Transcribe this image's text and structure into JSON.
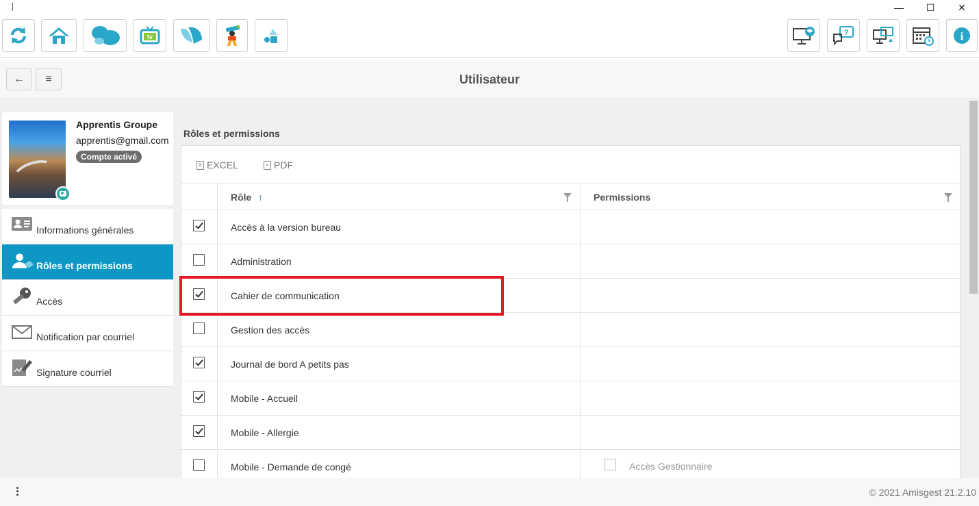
{
  "window": {
    "minimize": "—",
    "maximize": "☐",
    "close": "✕"
  },
  "toolbar": {
    "left_buttons": [
      "refresh-icon",
      "home-icon",
      "butterfly-icon",
      "tv-icon",
      "wings-icon",
      "kid-icon",
      "shapes-icon"
    ],
    "right_buttons": [
      "desktop-training-icon",
      "help-chat-icon",
      "remote-desktop-icon",
      "calendar-icon",
      "info-icon"
    ],
    "tv_label": "tv",
    "help_label": "?",
    "info_label": "i"
  },
  "header": {
    "back_icon": "←",
    "menu_icon": "≡",
    "title": "Utilisateur"
  },
  "profile": {
    "name": "Apprentis Groupe",
    "email": "apprentis@gmail.com",
    "status": "Compte activé"
  },
  "menu": {
    "items": [
      {
        "label": "Informations générales",
        "icon": "id-card-icon",
        "active": false
      },
      {
        "label": "Rôles et permissions",
        "icon": "user-tag-icon",
        "active": true
      },
      {
        "label": "Accès",
        "icon": "key-icon",
        "active": false
      },
      {
        "label": "Notification par courriel",
        "icon": "envelope-icon",
        "active": false
      },
      {
        "label": "Signature courriel",
        "icon": "signature-icon",
        "active": false
      }
    ]
  },
  "section": {
    "title": "Rôles et permissions"
  },
  "grid": {
    "excel_label": "EXCEL",
    "pdf_label": "PDF",
    "columns": {
      "role": "Rôle",
      "sort_icon": "↑",
      "permissions": "Permissions"
    },
    "rows": [
      {
        "checked": true,
        "role": "Accès à la version bureau",
        "permission": ""
      },
      {
        "checked": false,
        "role": "Administration",
        "permission": ""
      },
      {
        "checked": true,
        "role": "Cahier de communication",
        "permission": ""
      },
      {
        "checked": false,
        "role": "Gestion des accès",
        "permission": ""
      },
      {
        "checked": true,
        "role": "Journal de bord A petits pas",
        "permission": ""
      },
      {
        "checked": true,
        "role": "Mobile - Accueil",
        "permission": ""
      },
      {
        "checked": true,
        "role": "Mobile - Allergie",
        "permission": ""
      },
      {
        "checked": false,
        "role": "Mobile - Demande de congé",
        "permission": "Accès Gestionnaire"
      }
    ]
  },
  "footer": {
    "copyright": "© 2021 Amisgest 21.2.10"
  },
  "colors": {
    "accent": "#0d97c4",
    "highlight": "#e01b24",
    "badge": "#6d6d6d"
  }
}
